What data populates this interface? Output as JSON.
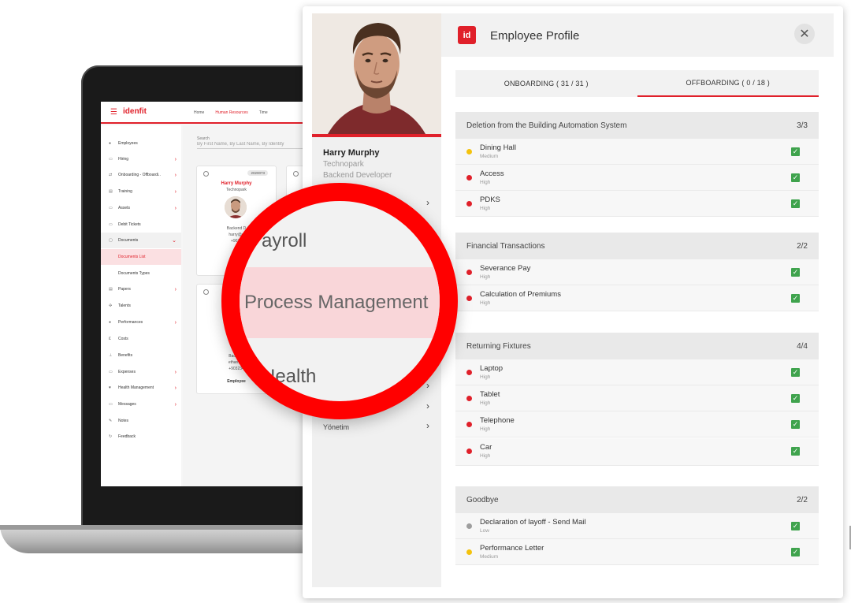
{
  "laptop_app": {
    "brand": "idenfit",
    "nav": [
      {
        "label": "Home",
        "active": false
      },
      {
        "label": "Human Resources",
        "active": true
      },
      {
        "label": "Time",
        "active": false
      }
    ],
    "sidebar": [
      {
        "label": "Employees",
        "icon": "person-icon",
        "chevron": false
      },
      {
        "label": "Hiring",
        "icon": "briefcase-icon",
        "chevron": true
      },
      {
        "label": "Onboarding - Offboardi..",
        "icon": "transfer-icon",
        "chevron": true
      },
      {
        "label": "Training",
        "icon": "training-icon",
        "chevron": true
      },
      {
        "label": "Assets",
        "icon": "laptop-icon",
        "chevron": true
      },
      {
        "label": "Debit Tickets",
        "icon": "ticket-icon",
        "chevron": false
      },
      {
        "label": "Documents",
        "icon": "document-icon",
        "chevron": true
      },
      {
        "label": "Documents List",
        "icon": "",
        "chevron": false
      },
      {
        "label": "Documents Types",
        "icon": "",
        "chevron": false
      },
      {
        "label": "Papers",
        "icon": "paper-icon",
        "chevron": true
      },
      {
        "label": "Talents",
        "icon": "talent-icon",
        "chevron": false
      },
      {
        "label": "Performances",
        "icon": "performance-icon",
        "chevron": true
      },
      {
        "label": "Costs",
        "icon": "cost-icon",
        "chevron": false
      },
      {
        "label": "Benefits",
        "icon": "benefit-icon",
        "chevron": false
      },
      {
        "label": "Expenses",
        "icon": "expense-icon",
        "chevron": true
      },
      {
        "label": "Health Management",
        "icon": "heart-icon",
        "chevron": true
      },
      {
        "label": "Messages",
        "icon": "message-icon",
        "chevron": true
      },
      {
        "label": "Notes",
        "icon": "note-icon",
        "chevron": false
      },
      {
        "label": "Feedback",
        "icon": "feedback-icon",
        "chevron": false
      }
    ],
    "search": {
      "label": "Search",
      "placeholder": "By First Name, By Last Name, By Identity"
    },
    "card1": {
      "tag": "2020073",
      "name": "Harry Murphy",
      "org": "Technopark",
      "line1": "Backend D",
      "line2": "harry@e",
      "line3": "+9032"
    },
    "card2": {
      "line1": "Backend",
      "line2": "ethan@e",
      "line3": "+903234",
      "line4": "Employee"
    }
  },
  "magnifier": {
    "row1": "ayroll",
    "row2": "Process Management",
    "row3": "Health"
  },
  "profile": {
    "name": "Harry Murphy",
    "company": "Technopark",
    "title": "Backend Developer",
    "left_bottom_label": "Yönetim"
  },
  "panel": {
    "logo": "id",
    "title": "Employee Profile",
    "close": "✕",
    "tabs": [
      {
        "label": "ONBOARDING ( 31 / 31 )",
        "active": false
      },
      {
        "label": "OFFBOARDING ( 0 / 18 )",
        "active": true
      }
    ]
  },
  "sections": [
    {
      "title": "Deletion from the Building Automation System",
      "count": "3/3",
      "tasks": [
        {
          "name": "Dining Hall",
          "priority": "Medium",
          "color": "#f4c20d"
        },
        {
          "name": "Access",
          "priority": "High",
          "color": "#e0202a"
        },
        {
          "name": "PDKS",
          "priority": "High",
          "color": "#e0202a"
        }
      ]
    },
    {
      "title": "Financial Transactions",
      "count": "2/2",
      "tasks": [
        {
          "name": "Severance Pay",
          "priority": "High",
          "color": "#e0202a"
        },
        {
          "name": "Calculation of Premiums",
          "priority": "High",
          "color": "#e0202a"
        }
      ]
    },
    {
      "title": "Returning Fixtures",
      "count": "4/4",
      "tasks": [
        {
          "name": "Laptop",
          "priority": "High",
          "color": "#e0202a"
        },
        {
          "name": "Tablet",
          "priority": "High",
          "color": "#e0202a"
        },
        {
          "name": "Telephone",
          "priority": "High",
          "color": "#e0202a"
        },
        {
          "name": "Car",
          "priority": "High",
          "color": "#e0202a"
        }
      ]
    },
    {
      "title": "Goodbye",
      "count": "2/2",
      "tasks": [
        {
          "name": "Declaration of layoff - Send Mail",
          "priority": "Low",
          "color": "#9e9e9e"
        },
        {
          "name": "Performance Letter",
          "priority": "Medium",
          "color": "#f4c20d"
        }
      ]
    }
  ],
  "colors": {
    "accent": "#e0202a",
    "done_check": "#3fa34d"
  }
}
